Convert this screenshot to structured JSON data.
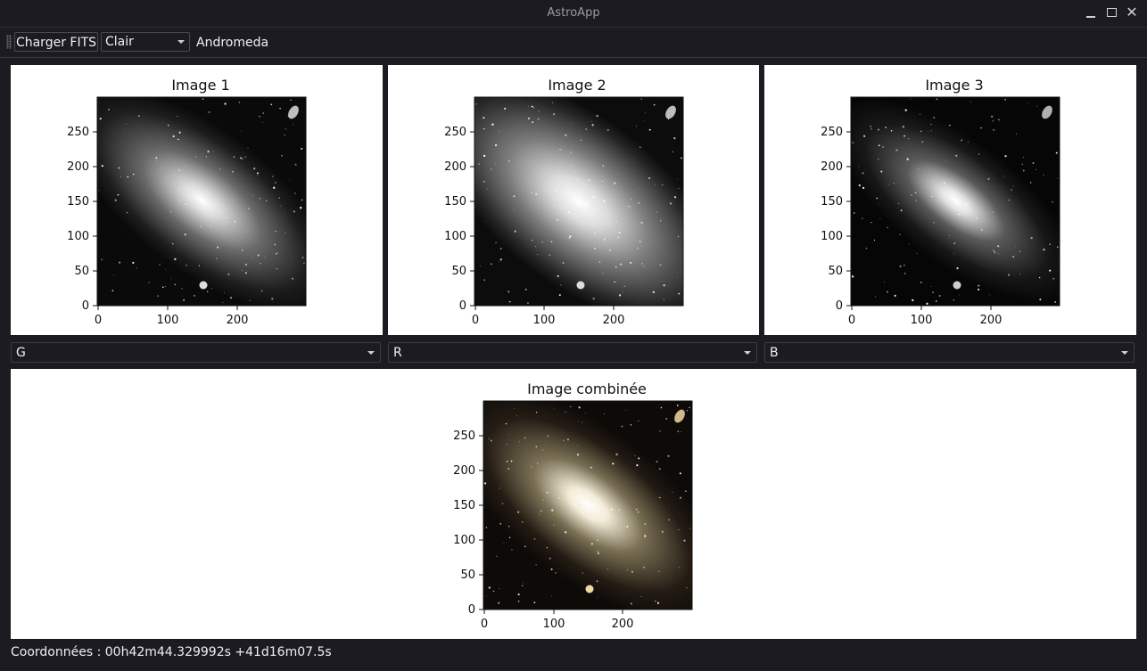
{
  "window": {
    "title": "AstroApp"
  },
  "toolbar": {
    "load_button": "Charger FITS",
    "theme_select": "Clair",
    "object_name": "Andromeda"
  },
  "plots": [
    {
      "title": "Image 1",
      "yticks": [
        "250",
        "200",
        "150",
        "100",
        "50",
        "0"
      ],
      "xticks": [
        "0",
        "100",
        "200"
      ],
      "colormap": "gray",
      "style": "p1"
    },
    {
      "title": "Image 2",
      "yticks": [
        "250",
        "200",
        "150",
        "100",
        "50",
        "0"
      ],
      "xticks": [
        "0",
        "100",
        "200"
      ],
      "colormap": "gray",
      "style": "p2"
    },
    {
      "title": "Image 3",
      "yticks": [
        "250",
        "200",
        "150",
        "100",
        "50",
        "0"
      ],
      "xticks": [
        "0",
        "100",
        "200"
      ],
      "colormap": "gray",
      "style": "p3"
    }
  ],
  "channels": [
    {
      "value": "G"
    },
    {
      "value": "R"
    },
    {
      "value": "B"
    }
  ],
  "combined": {
    "title": "Image combinée",
    "yticks": [
      "250",
      "200",
      "150",
      "100",
      "50",
      "0"
    ],
    "xticks": [
      "0",
      "100",
      "200"
    ]
  },
  "status": {
    "coordinates": "Coordonnées : 00h42m44.329992s +41d16m07.5s"
  },
  "colors": {
    "background": "#1c1b22",
    "panel": "#ffffff",
    "text": "#eaeaea"
  }
}
